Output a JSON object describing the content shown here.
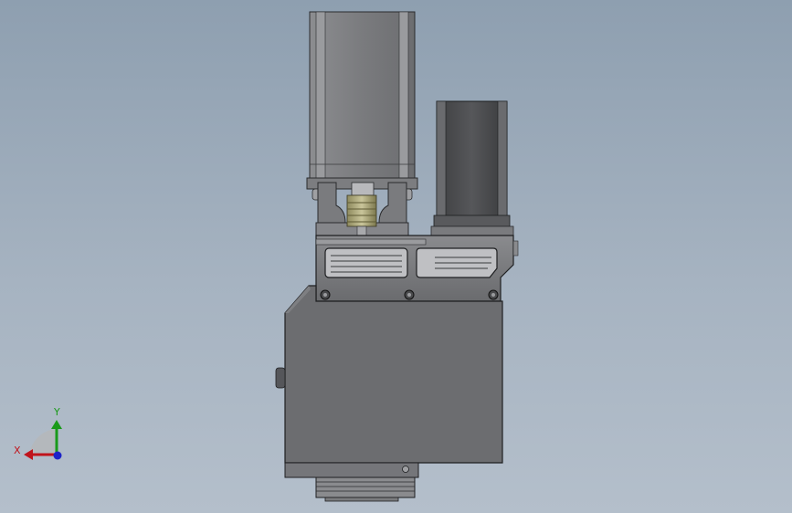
{
  "viewport": {
    "background_top": "#8e9fb0",
    "background_bottom": "#b4bfcb"
  },
  "triad": {
    "x_label": "X",
    "y_label": "Y",
    "x_color": "#c0141c",
    "y_color": "#1a9a1a",
    "z_color": "#1c22c8"
  },
  "model": {
    "parts": [
      {
        "name": "servo-motor",
        "color": "#7d7e80"
      },
      {
        "name": "stepper-motor",
        "color": "#4a4b4d"
      },
      {
        "name": "shaft-coupling",
        "color": "#a6a27a"
      },
      {
        "name": "mounting-plate",
        "color": "#75767a"
      },
      {
        "name": "main-housing",
        "color": "#6c6d70"
      },
      {
        "name": "output-flange",
        "color": "#8a8b8e"
      }
    ]
  }
}
